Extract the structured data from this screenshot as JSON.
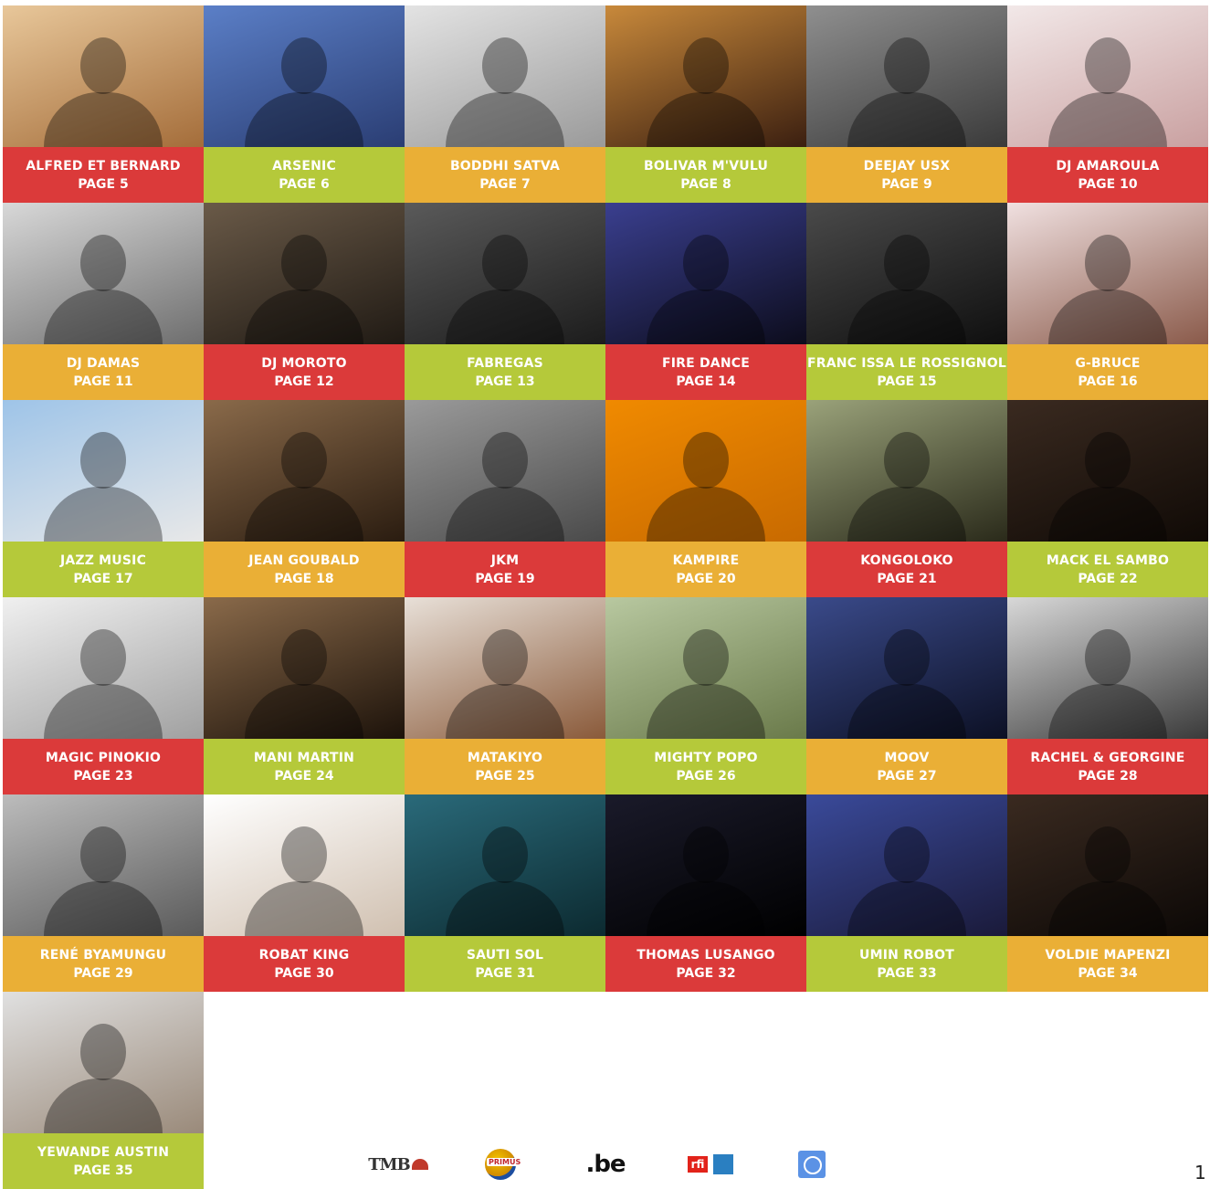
{
  "tiles": [
    {
      "name": "ALFRED ET BERNARD",
      "page": "PAGE 5",
      "color": "#db3a3a",
      "photo_bg": [
        "#e8c79a",
        "#a46d3a"
      ]
    },
    {
      "name": "ARSENIC",
      "page": "PAGE 6",
      "color": "#b5c93a",
      "photo_bg": [
        "#5b7fc7",
        "#2a3d73"
      ]
    },
    {
      "name": "BODDHI SATVA",
      "page": "PAGE 7",
      "color": "#eaaf36",
      "photo_bg": [
        "#e3e3e3",
        "#9a9a9a"
      ]
    },
    {
      "name": "BOLIVAR M'VULU",
      "page": "PAGE 8",
      "color": "#b5c93a",
      "photo_bg": [
        "#c8893b",
        "#3b1f10"
      ]
    },
    {
      "name": "DEEJAY USX",
      "page": "PAGE 9",
      "color": "#eaaf36",
      "photo_bg": [
        "#8f8f8f",
        "#3a3a3a"
      ]
    },
    {
      "name": "DJ AMAROULA",
      "page": "PAGE 10",
      "color": "#db3a3a",
      "photo_bg": [
        "#f2e8e8",
        "#c9a0a0"
      ]
    },
    {
      "name": "DJ DAMAS",
      "page": "PAGE 11",
      "color": "#eaaf36",
      "photo_bg": [
        "#d8d8d8",
        "#6e6e6e"
      ]
    },
    {
      "name": "DJ MOROTO",
      "page": "PAGE 12",
      "color": "#db3a3a",
      "photo_bg": [
        "#6a5a48",
        "#201a14"
      ]
    },
    {
      "name": "FABREGAS",
      "page": "PAGE 13",
      "color": "#b5c93a",
      "photo_bg": [
        "#5a5a5a",
        "#1c1c1c"
      ]
    },
    {
      "name": "FIRE DANCE",
      "page": "PAGE 14",
      "color": "#db3a3a",
      "photo_bg": [
        "#3a3f8f",
        "#0c0c1c"
      ]
    },
    {
      "name": "FRANC ISSA LE ROSSIGNOL",
      "page": "PAGE 15",
      "color": "#b5c93a",
      "photo_bg": [
        "#4a4a4a",
        "#0f0f0f"
      ]
    },
    {
      "name": "G-BRUCE",
      "page": "PAGE 16",
      "color": "#eaaf36",
      "photo_bg": [
        "#f0e0e0",
        "#8a5a4a"
      ]
    },
    {
      "name": "JAZZ MUSIC",
      "page": "PAGE 17",
      "color": "#b5c93a",
      "photo_bg": [
        "#9ec4e8",
        "#e8e8e8"
      ]
    },
    {
      "name": "JEAN GOUBALD",
      "page": "PAGE 18",
      "color": "#eaaf36",
      "photo_bg": [
        "#8a6a4a",
        "#2a1c10"
      ]
    },
    {
      "name": "JKM",
      "page": "PAGE 19",
      "color": "#db3a3a",
      "photo_bg": [
        "#9a9a9a",
        "#4a4a4a"
      ]
    },
    {
      "name": "KAMPIRE",
      "page": "PAGE 20",
      "color": "#eaaf36",
      "photo_bg": [
        "#f08a00",
        "#c86a00"
      ]
    },
    {
      "name": "KONGOLOKO",
      "page": "PAGE 21",
      "color": "#db3a3a",
      "photo_bg": [
        "#9aa27a",
        "#2a2a1a"
      ]
    },
    {
      "name": "MACK EL SAMBO",
      "page": "PAGE 22",
      "color": "#b5c93a",
      "photo_bg": [
        "#3a2a20",
        "#100a06"
      ]
    },
    {
      "name": "MAGIC PINOKIO",
      "page": "PAGE 23",
      "color": "#db3a3a",
      "photo_bg": [
        "#f0f0f0",
        "#a0a0a0"
      ]
    },
    {
      "name": "MANI MARTIN",
      "page": "PAGE 24",
      "color": "#b5c93a",
      "photo_bg": [
        "#8a6a4a",
        "#1c120a"
      ]
    },
    {
      "name": "MATAKIYO",
      "page": "PAGE 25",
      "color": "#eaaf36",
      "photo_bg": [
        "#e8e0d8",
        "#8a5a3a"
      ]
    },
    {
      "name": "MIGHTY POPO",
      "page": "PAGE 26",
      "color": "#b5c93a",
      "photo_bg": [
        "#b8c8a0",
        "#6a7a4a"
      ]
    },
    {
      "name": "MOOV",
      "page": "PAGE 27",
      "color": "#eaaf36",
      "photo_bg": [
        "#3a4a8a",
        "#0c1024"
      ]
    },
    {
      "name": "RACHEL & GEORGINE",
      "page": "PAGE 28",
      "color": "#db3a3a",
      "photo_bg": [
        "#d8d8d8",
        "#3a3a3a"
      ]
    },
    {
      "name": "RENÉ BYAMUNGU",
      "page": "PAGE 29",
      "color": "#eaaf36",
      "photo_bg": [
        "#bcbcbc",
        "#5a5a5a"
      ]
    },
    {
      "name": "ROBAT KING",
      "page": "PAGE 30",
      "color": "#db3a3a",
      "photo_bg": [
        "#ffffff",
        "#d0c0b0"
      ]
    },
    {
      "name": "SAUTI SOL",
      "page": "PAGE 31",
      "color": "#b5c93a",
      "photo_bg": [
        "#2a6a7a",
        "#0c2a30"
      ]
    },
    {
      "name": "THOMAS LUSANGO",
      "page": "PAGE 32",
      "color": "#db3a3a",
      "photo_bg": [
        "#1a1a2a",
        "#000000"
      ]
    },
    {
      "name": "UMIN ROBOT",
      "page": "PAGE 33",
      "color": "#b5c93a",
      "photo_bg": [
        "#3a4a9a",
        "#1a1a3a"
      ]
    },
    {
      "name": "VOLDIE MAPENZI",
      "page": "PAGE 34",
      "color": "#eaaf36",
      "photo_bg": [
        "#3a2a20",
        "#0c0806"
      ]
    },
    {
      "name": "YEWANDE AUSTIN",
      "page": "PAGE 35",
      "color": "#b5c93a",
      "photo_bg": [
        "#e0e0e0",
        "#9a8a7a"
      ]
    }
  ],
  "footer": {
    "logos": [
      "tmb-logo",
      "primus-logo",
      "be-logo",
      "rfi-france24-logo",
      "un-logo"
    ],
    "be_text": ".be",
    "rfi_text": "rfi",
    "primus_text": "PRIMUS",
    "tmb_text": "TMB",
    "page_number": "1"
  }
}
